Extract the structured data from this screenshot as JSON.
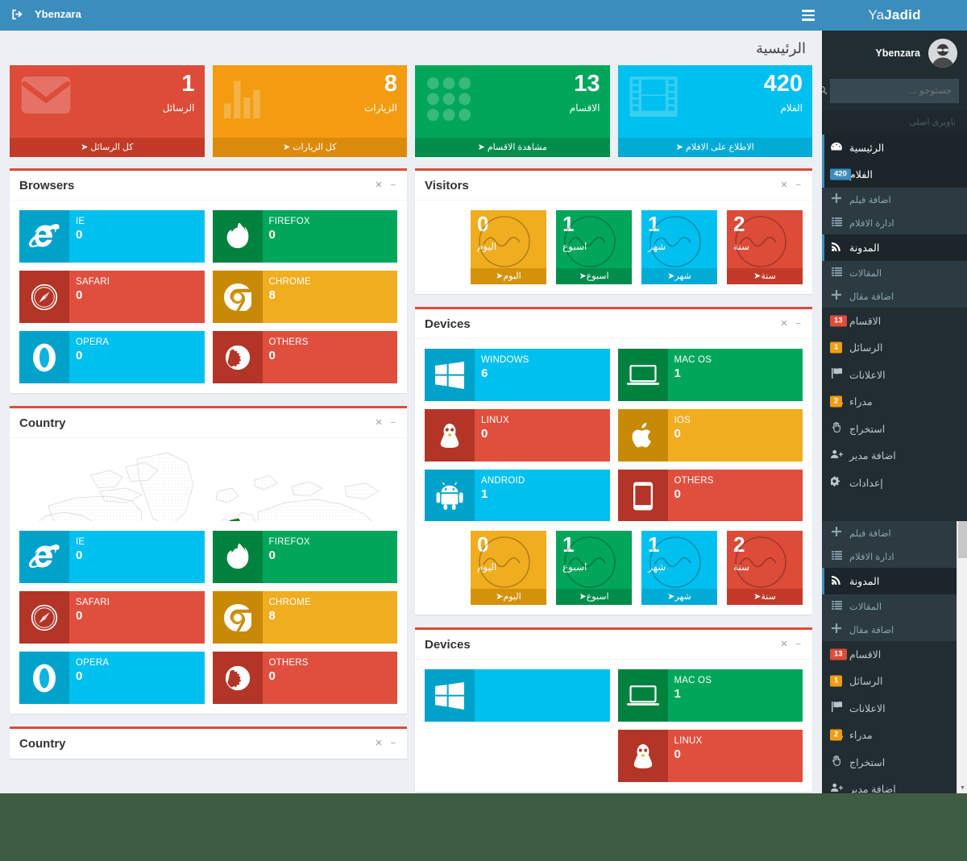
{
  "topbar": {
    "logout_icon": "sign-out-icon",
    "username": "Ybenzara",
    "menu_toggle_icon": "hamburger-icon"
  },
  "sidebar": {
    "brand_bold": "Jadid",
    "brand_light": "Ya",
    "user_name": "Ybenzara",
    "search_placeholder": "جستوجو ...",
    "search_value": "",
    "section_header": "ناوبری اصلی",
    "items": [
      {
        "label": "الرئيسية",
        "icon": "dashboard-icon",
        "badge": "",
        "badge_color": "",
        "state": "active",
        "level": "top"
      },
      {
        "label": "الفلام",
        "icon": "film-icon",
        "badge": "420",
        "badge_color": "#3c8dbc",
        "state": "active",
        "level": "top"
      },
      {
        "label": "اضافة فيلم",
        "icon": "plus-icon",
        "badge": "",
        "badge_color": "",
        "state": "sub",
        "level": "sub"
      },
      {
        "label": "ادارة الافلام",
        "icon": "list-icon",
        "badge": "",
        "badge_color": "",
        "state": "sub",
        "level": "sub"
      },
      {
        "label": "المدونة",
        "icon": "rss-icon",
        "badge": "",
        "badge_color": "",
        "state": "active",
        "level": "top"
      },
      {
        "label": "المقالات",
        "icon": "list-icon",
        "badge": "",
        "badge_color": "",
        "state": "sub",
        "level": "sub"
      },
      {
        "label": "اضافة مقال",
        "icon": "plus-icon",
        "badge": "",
        "badge_color": "",
        "state": "sub",
        "level": "sub"
      },
      {
        "label": "الاقسام",
        "icon": "list-icon",
        "badge": "13",
        "badge_color": "#dd4b39",
        "state": "normal",
        "level": "top"
      },
      {
        "label": "الرسائل",
        "icon": "envelope-icon",
        "badge": "1",
        "badge_color": "#f39c12",
        "state": "normal",
        "level": "top"
      },
      {
        "label": "الاعلانات",
        "icon": "flag-icon",
        "badge": "",
        "badge_color": "",
        "state": "normal",
        "level": "top"
      },
      {
        "label": "مدراء",
        "icon": "users-icon",
        "badge": "2",
        "badge_color": "#f39c12",
        "state": "normal",
        "level": "top"
      },
      {
        "label": "استخراج",
        "icon": "hand-icon",
        "badge": "",
        "badge_color": "",
        "state": "normal",
        "level": "top"
      },
      {
        "label": "اضافة مدير",
        "icon": "user-plus-icon",
        "badge": "",
        "badge_color": "",
        "state": "normal",
        "level": "top"
      },
      {
        "label": "إعدادات",
        "icon": "gears-icon",
        "badge": "",
        "badge_color": "",
        "state": "normal",
        "level": "top"
      }
    ]
  },
  "page": {
    "title": "الرئيسية"
  },
  "stats": [
    {
      "value": "420",
      "title": "الفلام",
      "footer": "الاطلاع على الافلام",
      "color": "aqua",
      "icon": "film-icon"
    },
    {
      "value": "13",
      "title": "الاقسام",
      "footer": "مشاهدة الاقسام",
      "color": "green",
      "icon": "grid-icon"
    },
    {
      "value": "8",
      "title": "الزيارات",
      "footer": "كل الزيارات",
      "color": "yellow",
      "icon": "bar-chart-icon"
    },
    {
      "value": "1",
      "title": "الرسائل",
      "footer": "كل الرسائل",
      "color": "red",
      "icon": "envelope-icon"
    }
  ],
  "panels": {
    "browsers": {
      "title": "Browsers",
      "tools": [
        "close-icon",
        "minimize-icon"
      ],
      "tiles": [
        {
          "name": "FIREFOX",
          "value": "0",
          "color": "green",
          "icon": "firefox-icon"
        },
        {
          "name": "IE",
          "value": "0",
          "color": "aqua",
          "icon": "internet-explorer-icon"
        },
        {
          "name": "CHROME",
          "value": "8",
          "color": "yellow",
          "icon": "chrome-icon"
        },
        {
          "name": "SAFARI",
          "value": "0",
          "color": "red",
          "icon": "safari-icon"
        },
        {
          "name": "OTHERS",
          "value": "0",
          "color": "red",
          "icon": "globe-icon"
        },
        {
          "name": "OPERA",
          "value": "0",
          "color": "aqua",
          "icon": "opera-icon"
        }
      ]
    },
    "visitors": {
      "title": "Visitors",
      "tools": [
        "close-icon",
        "minimize-icon"
      ],
      "tiles": [
        {
          "value": "2",
          "title": "سنة",
          "footer": "سنة",
          "color": "red"
        },
        {
          "value": "1",
          "title": "شهر",
          "footer": "شهر",
          "color": "aqua"
        },
        {
          "value": "1",
          "title": "اسبوع",
          "footer": "اسبوع",
          "color": "green"
        },
        {
          "value": "0",
          "title": "اليوم",
          "footer": "اليوم",
          "color": "yellow"
        }
      ]
    },
    "devices": {
      "title": "Devices",
      "tools": [
        "close-icon",
        "minimize-icon"
      ],
      "tiles": [
        {
          "name": "MAC OS",
          "value": "1",
          "color": "green",
          "icon": "laptop-icon"
        },
        {
          "name": "WINDOWS",
          "value": "6",
          "color": "aqua",
          "icon": "windows-icon"
        },
        {
          "name": "IOS",
          "value": "0",
          "color": "yellow",
          "icon": "apple-icon"
        },
        {
          "name": "LINUX",
          "value": "0",
          "color": "red",
          "icon": "linux-icon"
        },
        {
          "name": "OTHERS",
          "value": "0",
          "color": "red",
          "icon": "mobile-icon"
        },
        {
          "name": "ANDROID",
          "value": "1",
          "color": "aqua",
          "icon": "android-icon"
        }
      ]
    },
    "country": {
      "title": "Country",
      "tools": [
        "close-icon",
        "minimize-icon"
      ],
      "highlighted_region": "Finland",
      "highlight_color": "#1f7a1f"
    }
  },
  "colors": {
    "brand_blue": "#3b8dbd",
    "sidebar_dark": "#222d32",
    "page_bg": "#eceff3",
    "accent_red": "#dd4b39",
    "accent_green": "#00a65a",
    "accent_aqua": "#00c0ef",
    "accent_yellow": "#f0ad1f",
    "desktop_bg": "#3e5c41"
  }
}
